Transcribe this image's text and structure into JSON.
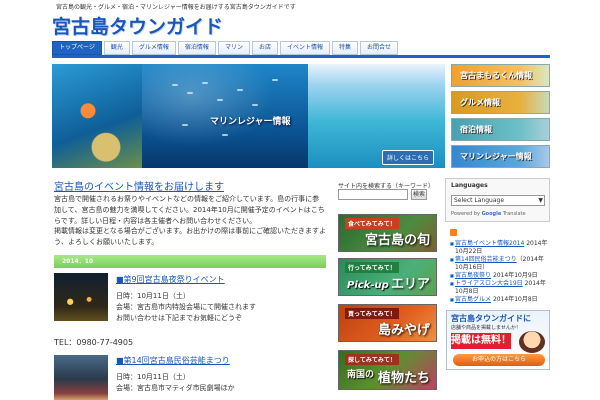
{
  "header": {
    "tagline": "宮古島の観光・グルメ・宿泊・マリンレジャー情報をお届けする宮古島タウンガイドです",
    "logo": "宮古島タウンガイド"
  },
  "nav": {
    "tabs": [
      "トップページ",
      "観光",
      "グルメ情報",
      "宿泊情報",
      "マリン",
      "お店",
      "イベント情報",
      "特集",
      "お問合せ"
    ]
  },
  "hero": {
    "title": "マリンレジャー情報",
    "more_label": "詳しくはこちら"
  },
  "side_banners": [
    "宮古まもるくん情報",
    "グルメ情報",
    "宿泊情報",
    "マリンレジャー情報"
  ],
  "main": {
    "post_heading": "宮古島のイベント情報をお届けします",
    "para1": "宮古島で開催されるお祭りやイベントなどの情報をご紹介しています。島の行事に参加して、宮古島の魅力を満喫してください。2014年10月に開催予定のイベントはこちらです。詳しい日程・内容は各主催者へお問い合わせください。",
    "para2": "掲載情報は変更となる場合がございます。お出かけの際は事前にご確認いただきますよう、よろしくお願いいたします。",
    "date_bar": "2014．10",
    "entries": [
      {
        "title": "■第9回宮古島夜祭りイベント",
        "body": "日時：10月11日（土）\n会場：宮古島市内特設会場にて開催されます\nお問い合わせは下記までお気軽にどうぞ"
      },
      {
        "title": "■第14回宮古島民俗芸能まつり",
        "body": "日時：10月11日（土）\n会場：宮古島市マティダ市民劇場ほか"
      }
    ],
    "tel": "TEL：0980-77-4905"
  },
  "search": {
    "label": "サイト内を検索する（キーワード）",
    "placeholder": "",
    "button": "検索"
  },
  "features": [
    {
      "small": "食べてみてみて！",
      "big": "宮古島の旬"
    },
    {
      "small": "行ってみてみて！",
      "big": "エリア",
      "pick": "Pick-up"
    },
    {
      "small": "買ってみてみて！",
      "big": "島みやげ"
    },
    {
      "small": "探してみてみて！",
      "mid": "南国の",
      "big": "植物たち"
    }
  ],
  "languages": {
    "title": "Languages",
    "selected": "Select Language",
    "powered_by": "Powered by",
    "google": "Google",
    "translate": "Translate"
  },
  "recent": [
    {
      "title": "宮古島イベント情報2014",
      "date": "2014年10月22日"
    },
    {
      "title": "第14回民俗芸能まつり",
      "date": "（2014年10月16日）"
    },
    {
      "title": "宮古島夜祭り",
      "date": "2014年10月9日"
    },
    {
      "title": "トライアスロン大会19日",
      "date": "2014年10月8日"
    },
    {
      "title": "宮古島グルメ",
      "date": "2014年10月8日"
    }
  ],
  "ad": {
    "title": "宮古島タウンガイドに",
    "subtitle": "店舗や商品を掲載しませんか！",
    "free": "掲載は無料！",
    "apply": "お申込の方はこちら"
  }
}
